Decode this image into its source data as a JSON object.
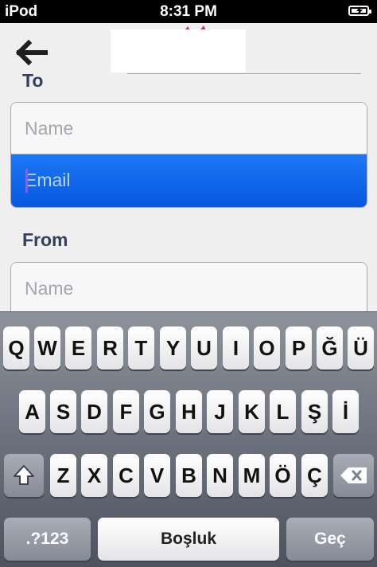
{
  "status_bar": {
    "carrier": "iPod",
    "time": "8:31 PM"
  },
  "form": {
    "to_label": "To",
    "to_name_placeholder": "Name",
    "to_email_placeholder": "Email",
    "from_label": "From",
    "from_name_placeholder": "Name"
  },
  "keyboard": {
    "row1": [
      "Q",
      "W",
      "E",
      "R",
      "T",
      "Y",
      "U",
      "I",
      "O",
      "P",
      "Ğ",
      "Ü"
    ],
    "row2": [
      "A",
      "S",
      "D",
      "F",
      "G",
      "H",
      "J",
      "K",
      "L",
      "Ş",
      "İ"
    ],
    "row3": [
      "Z",
      "X",
      "C",
      "V",
      "B",
      "N",
      "M",
      "Ö",
      "Ç"
    ],
    "numbers_label": ".?123",
    "space_label": "Boşluk",
    "return_label": "Geç"
  },
  "icons": {
    "back": "arrow-left-icon",
    "shift": "shift-icon",
    "delete": "backspace-icon",
    "battery": "battery-charging-icon"
  },
  "colors": {
    "focus_field": "#1e78f4",
    "label_text": "#34405a",
    "placeholder": "#a6a6aa"
  }
}
